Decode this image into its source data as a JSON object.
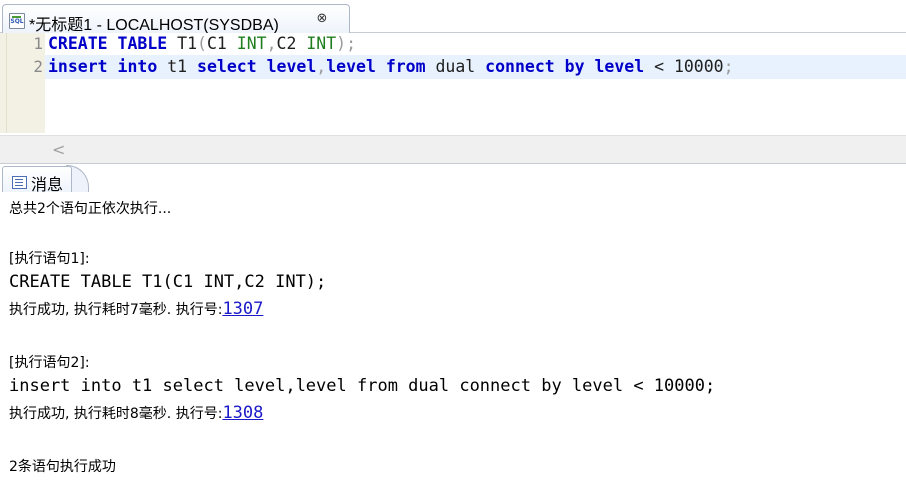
{
  "editor_tab": {
    "title": "*无标题1 - LOCALHOST(SYSDBA)",
    "close_symbol": "⊗",
    "icon": "sql-file-icon",
    "icon_text": "SQL"
  },
  "editor": {
    "lines": [
      {
        "number": "1"
      },
      {
        "number": "2"
      }
    ],
    "line1_tokens": [
      "CREATE",
      " ",
      "TABLE",
      " T1",
      "(",
      "C1 ",
      "INT",
      ",",
      "C2 ",
      "INT",
      ");"
    ],
    "line2_tokens": [
      "insert",
      " ",
      "into",
      " t1 ",
      "select",
      " ",
      "level",
      ",",
      "level",
      " ",
      "from",
      " dual ",
      "connect",
      " ",
      "by",
      " ",
      "level",
      " < 10000",
      ";"
    ],
    "scroll_left": "<"
  },
  "messages_panel": {
    "tab_label": "消息",
    "icon": "message-icon",
    "summary": "总共2个语句正依次执行...",
    "statement1_header": "[执行语句1]:",
    "statement1_sql": "CREATE TABLE T1(C1 INT,C2 INT);",
    "statement1_result": "执行成功, 执行耗时7毫秒. 执行号:",
    "statement1_exec_no": "1307",
    "statement2_header": "[执行语句2]:",
    "statement2_sql": "insert into t1 select level,level from dual connect by level < 10000;",
    "statement2_result": "执行成功, 执行耗时8毫秒. 执行号:",
    "statement2_exec_no": "1308",
    "final": "2条语句执行成功"
  },
  "colors": {
    "keyword": "#0000c8",
    "type": "#1f7f1f",
    "punctuation": "#9b9b9b",
    "current_line": "#e8f2fe",
    "link": "#1a1ac8"
  }
}
